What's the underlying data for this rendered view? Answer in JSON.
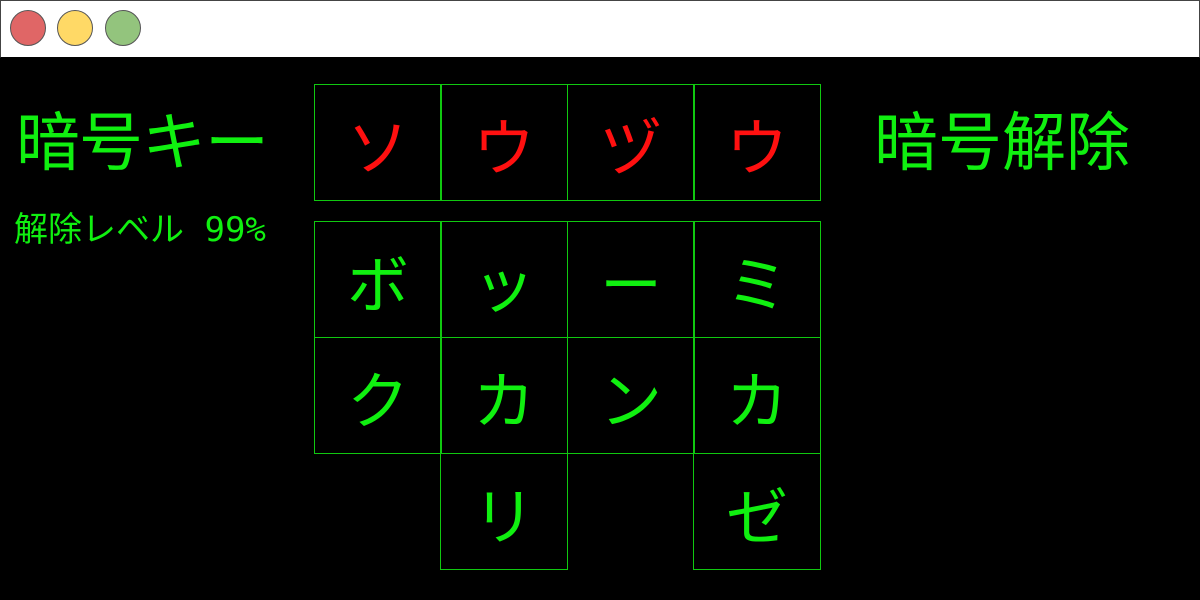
{
  "window": {
    "traffic_lights": [
      {
        "name": "close",
        "color": "#e06666"
      },
      {
        "name": "minimize",
        "color": "#ffd966"
      },
      {
        "name": "maximize",
        "color": "#93c47d"
      }
    ]
  },
  "labels": {
    "key_title": "暗号キー",
    "unlock_level": "解除レベル 99%",
    "unlock_title": "暗号解除"
  },
  "key_cells": [
    "ソ",
    "ウ",
    "ヅ",
    "ウ"
  ],
  "grid": [
    [
      "ボ",
      "ッ",
      "ー",
      "ミ"
    ],
    [
      "ク",
      "カ",
      "ン",
      "カ"
    ],
    [
      "",
      "リ",
      "",
      "ゼ"
    ]
  ],
  "colors": {
    "background": "#000000",
    "text_green": "#10f010",
    "border_green": "#10c810",
    "key_red": "#ff1010"
  }
}
